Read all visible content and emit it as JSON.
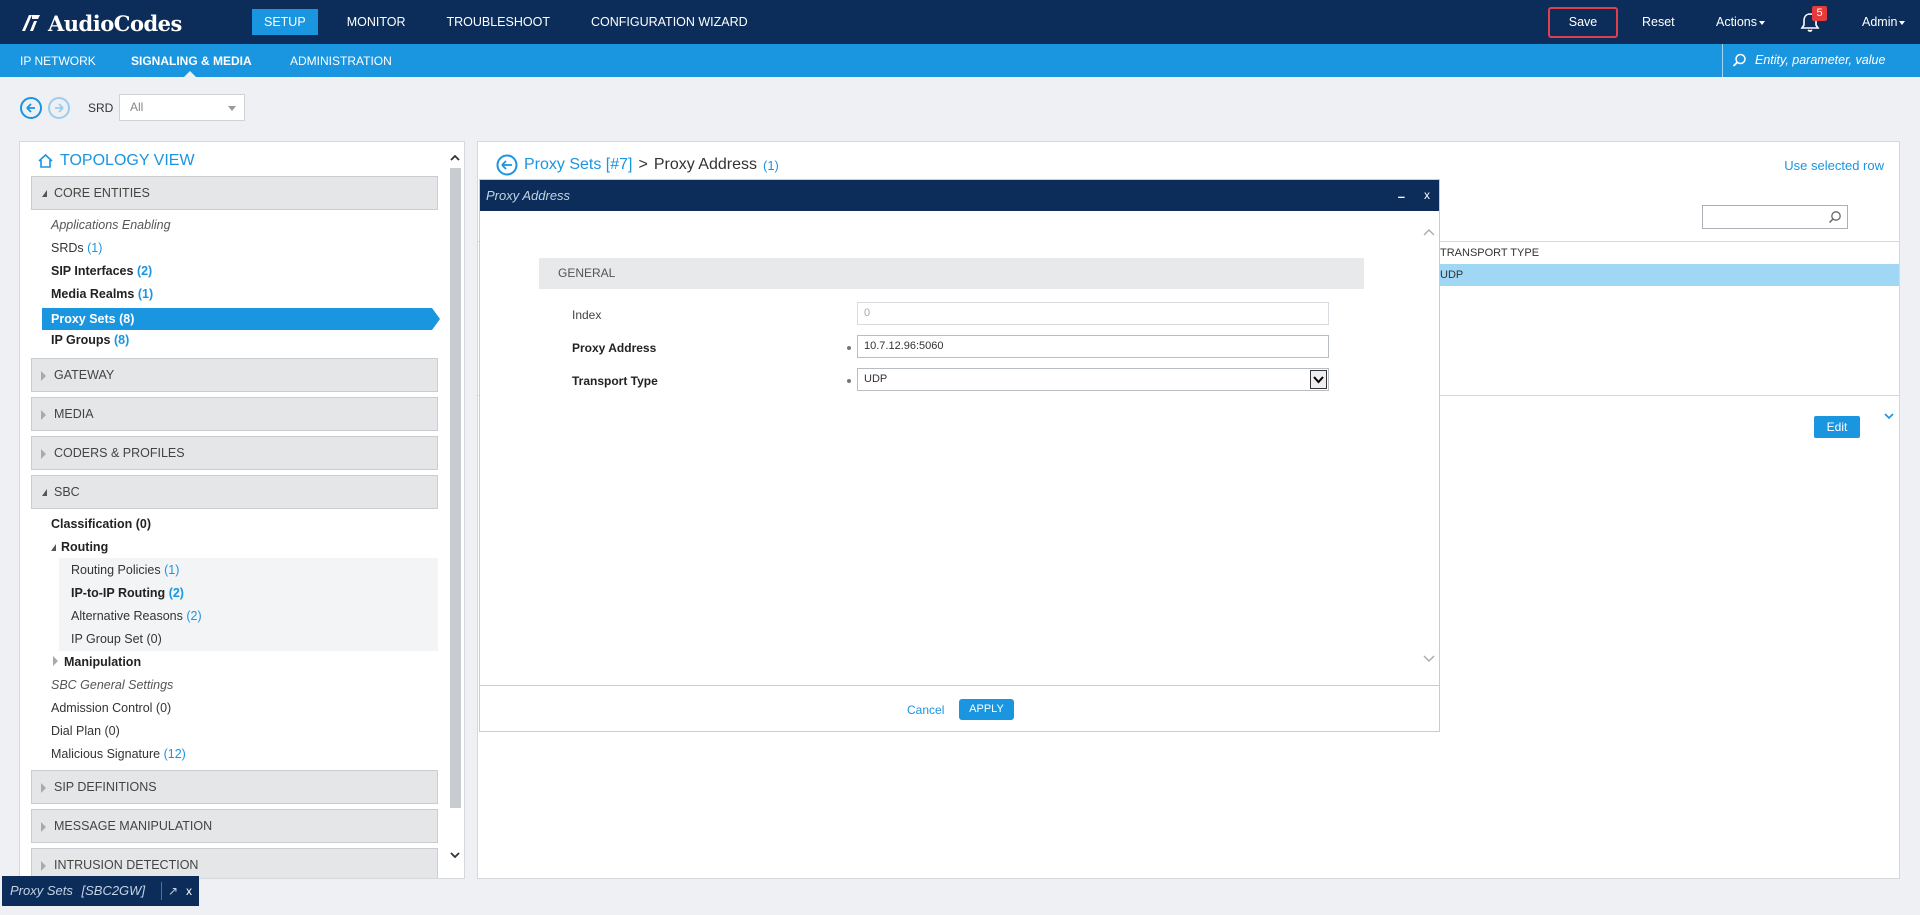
{
  "app": {
    "brand": "AudioCodes",
    "main_nav": [
      "SETUP",
      "MONITOR",
      "TROUBLESHOOT",
      "CONFIGURATION WIZARD"
    ],
    "active_main": "SETUP",
    "save_label": "Save",
    "reset_label": "Reset",
    "actions_label": "Actions",
    "notification_count": "5",
    "user_label": "Admin",
    "sub_nav": [
      "IP NETWORK",
      "SIGNALING & MEDIA",
      "ADMINISTRATION"
    ],
    "active_sub": "SIGNALING & MEDIA",
    "search_placeholder": "Entity, parameter, value"
  },
  "srd": {
    "label": "SRD",
    "value": "All"
  },
  "topology": {
    "title": "TOPOLOGY VIEW",
    "core_entities": "CORE ENTITIES",
    "core_items": [
      {
        "label": "Applications Enabling",
        "count": ""
      },
      {
        "label": "SRDs",
        "count": "(1)"
      },
      {
        "label": "SIP Interfaces",
        "count": "(2)"
      },
      {
        "label": "Media Realms",
        "count": "(1)"
      },
      {
        "label": "Proxy Sets (8)",
        "count": ""
      },
      {
        "label": "IP Groups",
        "count": "(8)"
      }
    ],
    "gateway": "GATEWAY",
    "media": "MEDIA",
    "coders": "CODERS & PROFILES",
    "sbc": "SBC",
    "sbc_items": {
      "classification": "Classification (0)",
      "routing": "Routing",
      "routing_policies": "Routing Policies",
      "routing_policies_count": "(1)",
      "ip_to_ip": "IP-to-IP Routing",
      "ip_to_ip_count": "(2)",
      "alt_reasons": "Alternative Reasons",
      "alt_reasons_count": "(2)",
      "ip_group_set": "IP Group Set (0)",
      "manipulation": "Manipulation",
      "general_settings": "SBC General Settings",
      "admission": "Admission Control (0)",
      "dial_plan": "Dial Plan (0)",
      "malicious": "Malicious Signature",
      "malicious_count": "(12)"
    },
    "sip_definitions": "SIP DEFINITIONS",
    "message_manipulation": "MESSAGE MANIPULATION",
    "intrusion_detection": "INTRUSION DETECTION"
  },
  "content": {
    "breadcrumb_parent": "Proxy Sets [#7]",
    "breadcrumb_sep": ">",
    "breadcrumb_current": "Proxy Address",
    "breadcrumb_count": "(1)",
    "use_selected_row": "Use selected row",
    "table_header": "TRANSPORT TYPE",
    "table_row_value": "UDP",
    "edit_label": "Edit"
  },
  "modal": {
    "title": "Proxy Address",
    "min_label": "–",
    "close_label": "x",
    "section": "GENERAL",
    "fields": {
      "index_label": "Index",
      "index_value": "0",
      "proxy_label": "Proxy Address",
      "proxy_value": "10.7.12.96:5060",
      "transport_label": "Transport Type",
      "transport_value": "UDP"
    },
    "cancel_label": "Cancel",
    "apply_label": "APPLY"
  },
  "bottom_tab": {
    "label": "Proxy Sets",
    "context": "[SBC2GW]",
    "close": "x"
  }
}
